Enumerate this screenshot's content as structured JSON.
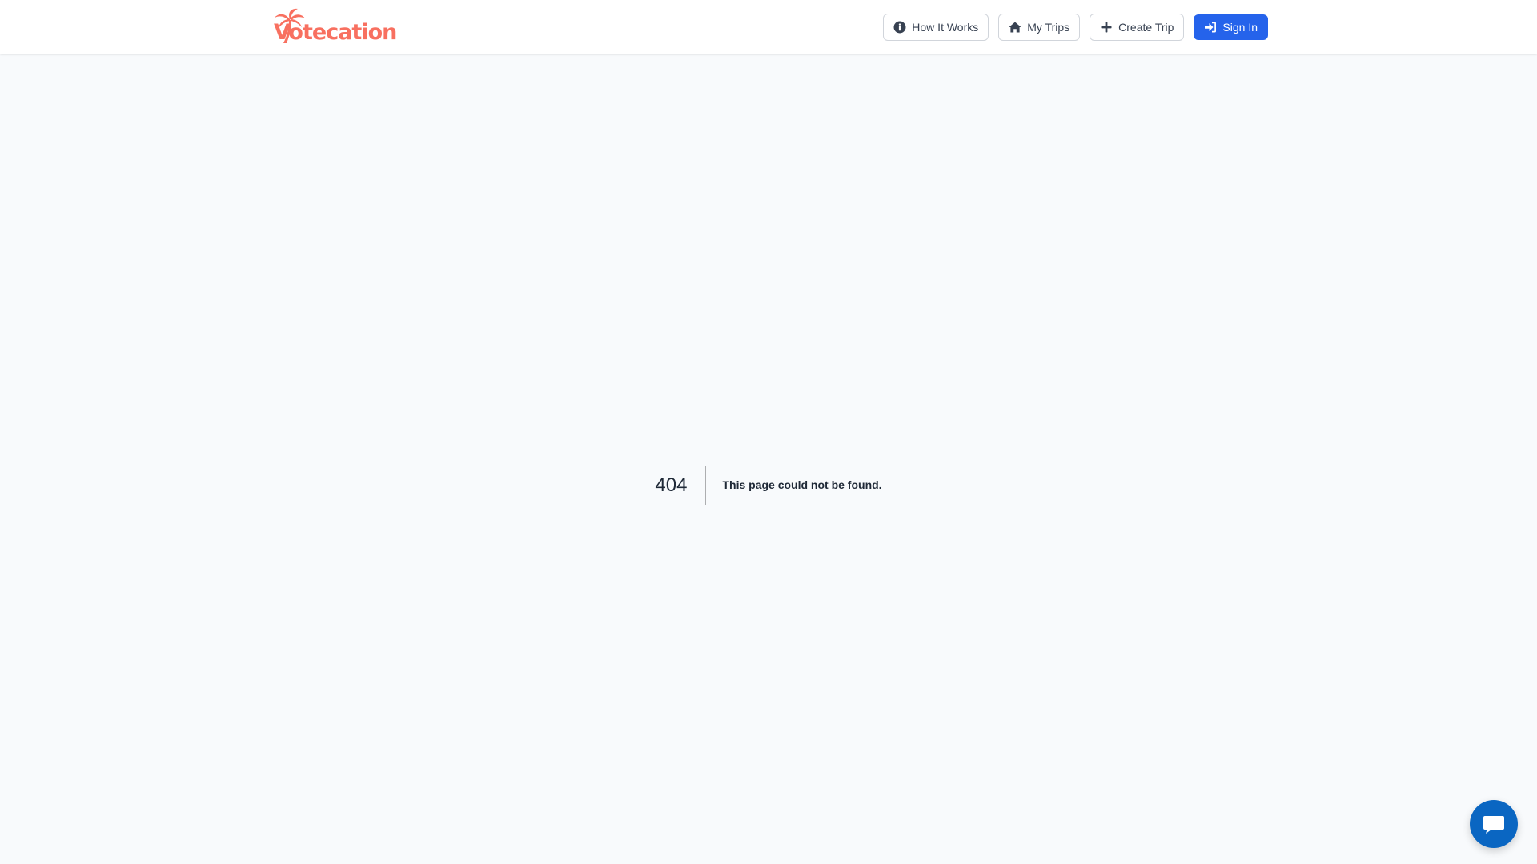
{
  "header": {
    "logo_text": "Votecation",
    "nav": {
      "how_it_works": "How It Works",
      "my_trips": "My Trips",
      "create_trip": "Create Trip",
      "sign_in": "Sign In"
    }
  },
  "not_found": {
    "code": "404",
    "message": "This page could not be found."
  },
  "icons": {
    "logo": "palm-tree-icon",
    "how_it_works": "info-circle-icon",
    "my_trips": "home-icon",
    "create_trip": "plus-icon",
    "sign_in": "sign-in-icon",
    "chat": "chat-bubble-icon"
  },
  "colors": {
    "brand": "#f87060",
    "primary": "#2563eb",
    "chat": "#0a66c2",
    "background": "#f8fafc"
  }
}
